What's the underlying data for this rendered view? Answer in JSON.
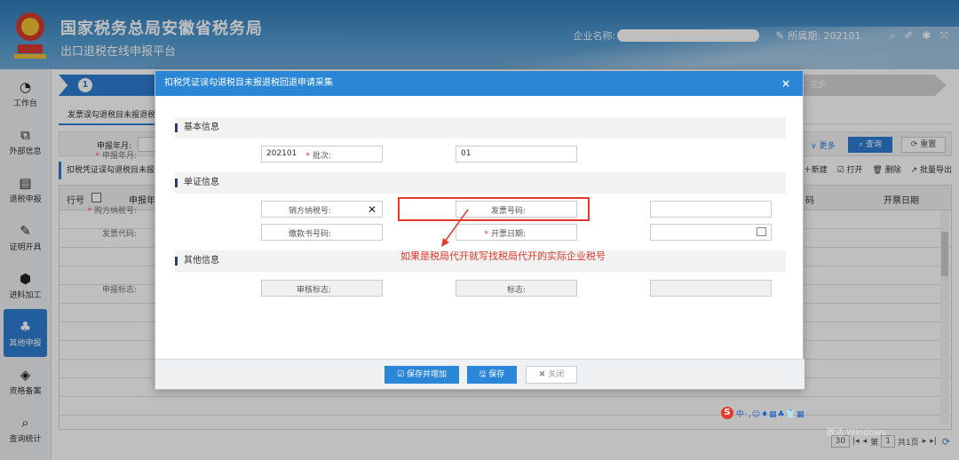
{
  "header": {
    "title": "国家税务总局安徽省税务局",
    "subtitle": "出口退税在线申报平台",
    "company_label": "企业名称:",
    "period": "所属期: 202101"
  },
  "sidebar": {
    "items": [
      {
        "label": "工作台",
        "icon": "dashboard-icon",
        "glyph": "◔"
      },
      {
        "label": "外部信息",
        "icon": "external-info-icon",
        "glyph": "⧉"
      },
      {
        "label": "退税申报",
        "icon": "document-icon",
        "glyph": "▤"
      },
      {
        "label": "证明开具",
        "icon": "edit-icon",
        "glyph": "✎"
      },
      {
        "label": "进料加工",
        "icon": "shield-icon",
        "glyph": "⬢"
      },
      {
        "label": "其他申报",
        "icon": "org-chart-icon",
        "glyph": "♣"
      },
      {
        "label": "资格备案",
        "icon": "cube-icon",
        "glyph": "◈"
      },
      {
        "label": "查询统计",
        "icon": "search-icon",
        "glyph": "⌕"
      }
    ]
  },
  "main": {
    "step1_number": "1",
    "step_last_label": "完步",
    "tab_label": "发票误勾退税目未报退税回退",
    "filter": {
      "period_label": "申报年月:",
      "more": "∨ 更多",
      "query": "⌕ 查询",
      "reset": "⟳ 重置"
    },
    "grid_title": "扣税凭证误勾退税目未报退",
    "grid_tools": [
      "＋新建",
      "☑ 打开",
      "🗑 删除",
      "↗ 批量导出"
    ],
    "table_headers": {
      "row_no": "行号",
      "period": "申报年",
      "code": "码",
      "date": "开票日期"
    },
    "pager": {
      "size": "30",
      "page_prefix": "第",
      "page": "1",
      "total": "共1页"
    }
  },
  "modal": {
    "title": "扣税凭证误勾退税目未报退税回退申请采集",
    "close": "×",
    "sections": {
      "basic": "基本信息",
      "voucher": "单证信息",
      "other": "其他信息"
    },
    "fields": {
      "period": {
        "label": "申报年月:",
        "value": "202101"
      },
      "batch": {
        "label": "批次:",
        "value": "01"
      },
      "buyer_tax_id": {
        "label": "购方纳税号:",
        "value": ""
      },
      "seller_tax_id": {
        "label": "销方纳税号:",
        "value": ""
      },
      "invoice_no": {
        "label": "发票号码:",
        "value": ""
      },
      "invoice_code": {
        "label": "发票代码:",
        "value": ""
      },
      "payment_no": {
        "label": "缴款书号码:",
        "value": ""
      },
      "issue_date": {
        "label": "开票日期:",
        "value": ""
      },
      "declare_flag": {
        "label": "申报标志:",
        "value": ""
      },
      "audit_flag": {
        "label": "审核标志:",
        "value": ""
      },
      "flag": {
        "label": "标志:",
        "value": ""
      }
    },
    "annotation": "如果是税局代开就写找税局代开的实际企业税号",
    "buttons": {
      "save_add": "☑ 保存并增加",
      "save": "🖫 保存",
      "close": "✖ 关闭"
    }
  },
  "ime": {
    "logo": "S",
    "rest": "中·,☺♦▦♣👕▦"
  },
  "watermark": "激活 Windows"
}
